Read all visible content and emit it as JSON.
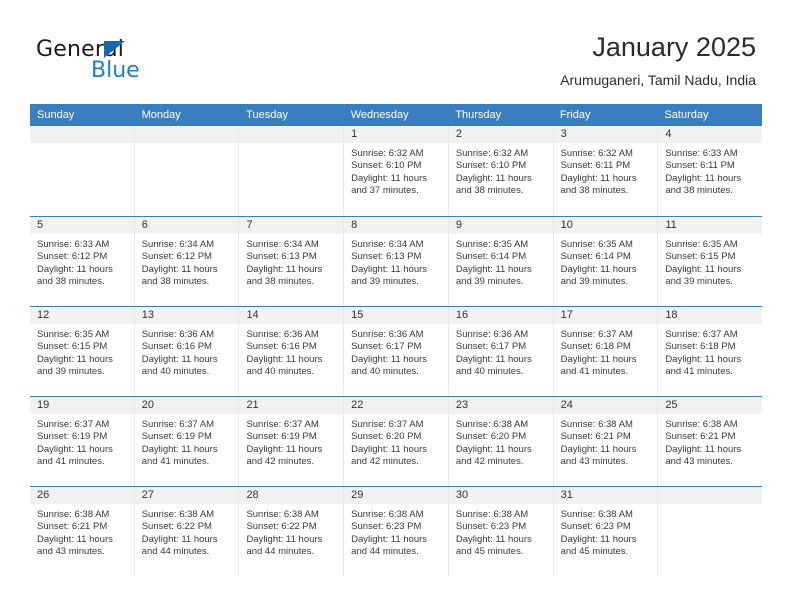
{
  "brand": {
    "name_part1": "General",
    "name_part2": "Blue",
    "triangle_color": "#1769b0",
    "blue_color": "#1f7fc4"
  },
  "header": {
    "title": "January 2025",
    "subtitle": "Arumuganeri, Tamil Nadu, India"
  },
  "theme": {
    "header_row_bg": "#3b7ebf",
    "day_number_bg": "#f1f1f1",
    "grid_line": "#3b7ebf",
    "cell_divider": "#e8e8e8"
  },
  "weekdays": [
    "Sunday",
    "Monday",
    "Tuesday",
    "Wednesday",
    "Thursday",
    "Friday",
    "Saturday"
  ],
  "labels": {
    "sunrise": "Sunrise:",
    "sunset": "Sunset:",
    "daylight": "Daylight:"
  },
  "weeks": [
    [
      {
        "day": "",
        "empty": true
      },
      {
        "day": "",
        "empty": true
      },
      {
        "day": "",
        "empty": true
      },
      {
        "day": "1",
        "sunrise": "Sunrise: 6:32 AM",
        "sunset": "Sunset: 6:10 PM",
        "daylight1": "Daylight: 11 hours",
        "daylight2": "and 37 minutes."
      },
      {
        "day": "2",
        "sunrise": "Sunrise: 6:32 AM",
        "sunset": "Sunset: 6:10 PM",
        "daylight1": "Daylight: 11 hours",
        "daylight2": "and 38 minutes."
      },
      {
        "day": "3",
        "sunrise": "Sunrise: 6:32 AM",
        "sunset": "Sunset: 6:11 PM",
        "daylight1": "Daylight: 11 hours",
        "daylight2": "and 38 minutes."
      },
      {
        "day": "4",
        "sunrise": "Sunrise: 6:33 AM",
        "sunset": "Sunset: 6:11 PM",
        "daylight1": "Daylight: 11 hours",
        "daylight2": "and 38 minutes."
      }
    ],
    [
      {
        "day": "5",
        "sunrise": "Sunrise: 6:33 AM",
        "sunset": "Sunset: 6:12 PM",
        "daylight1": "Daylight: 11 hours",
        "daylight2": "and 38 minutes."
      },
      {
        "day": "6",
        "sunrise": "Sunrise: 6:34 AM",
        "sunset": "Sunset: 6:12 PM",
        "daylight1": "Daylight: 11 hours",
        "daylight2": "and 38 minutes."
      },
      {
        "day": "7",
        "sunrise": "Sunrise: 6:34 AM",
        "sunset": "Sunset: 6:13 PM",
        "daylight1": "Daylight: 11 hours",
        "daylight2": "and 38 minutes."
      },
      {
        "day": "8",
        "sunrise": "Sunrise: 6:34 AM",
        "sunset": "Sunset: 6:13 PM",
        "daylight1": "Daylight: 11 hours",
        "daylight2": "and 39 minutes."
      },
      {
        "day": "9",
        "sunrise": "Sunrise: 6:35 AM",
        "sunset": "Sunset: 6:14 PM",
        "daylight1": "Daylight: 11 hours",
        "daylight2": "and 39 minutes."
      },
      {
        "day": "10",
        "sunrise": "Sunrise: 6:35 AM",
        "sunset": "Sunset: 6:14 PM",
        "daylight1": "Daylight: 11 hours",
        "daylight2": "and 39 minutes."
      },
      {
        "day": "11",
        "sunrise": "Sunrise: 6:35 AM",
        "sunset": "Sunset: 6:15 PM",
        "daylight1": "Daylight: 11 hours",
        "daylight2": "and 39 minutes."
      }
    ],
    [
      {
        "day": "12",
        "sunrise": "Sunrise: 6:35 AM",
        "sunset": "Sunset: 6:15 PM",
        "daylight1": "Daylight: 11 hours",
        "daylight2": "and 39 minutes."
      },
      {
        "day": "13",
        "sunrise": "Sunrise: 6:36 AM",
        "sunset": "Sunset: 6:16 PM",
        "daylight1": "Daylight: 11 hours",
        "daylight2": "and 40 minutes."
      },
      {
        "day": "14",
        "sunrise": "Sunrise: 6:36 AM",
        "sunset": "Sunset: 6:16 PM",
        "daylight1": "Daylight: 11 hours",
        "daylight2": "and 40 minutes."
      },
      {
        "day": "15",
        "sunrise": "Sunrise: 6:36 AM",
        "sunset": "Sunset: 6:17 PM",
        "daylight1": "Daylight: 11 hours",
        "daylight2": "and 40 minutes."
      },
      {
        "day": "16",
        "sunrise": "Sunrise: 6:36 AM",
        "sunset": "Sunset: 6:17 PM",
        "daylight1": "Daylight: 11 hours",
        "daylight2": "and 40 minutes."
      },
      {
        "day": "17",
        "sunrise": "Sunrise: 6:37 AM",
        "sunset": "Sunset: 6:18 PM",
        "daylight1": "Daylight: 11 hours",
        "daylight2": "and 41 minutes."
      },
      {
        "day": "18",
        "sunrise": "Sunrise: 6:37 AM",
        "sunset": "Sunset: 6:18 PM",
        "daylight1": "Daylight: 11 hours",
        "daylight2": "and 41 minutes."
      }
    ],
    [
      {
        "day": "19",
        "sunrise": "Sunrise: 6:37 AM",
        "sunset": "Sunset: 6:19 PM",
        "daylight1": "Daylight: 11 hours",
        "daylight2": "and 41 minutes."
      },
      {
        "day": "20",
        "sunrise": "Sunrise: 6:37 AM",
        "sunset": "Sunset: 6:19 PM",
        "daylight1": "Daylight: 11 hours",
        "daylight2": "and 41 minutes."
      },
      {
        "day": "21",
        "sunrise": "Sunrise: 6:37 AM",
        "sunset": "Sunset: 6:19 PM",
        "daylight1": "Daylight: 11 hours",
        "daylight2": "and 42 minutes."
      },
      {
        "day": "22",
        "sunrise": "Sunrise: 6:37 AM",
        "sunset": "Sunset: 6:20 PM",
        "daylight1": "Daylight: 11 hours",
        "daylight2": "and 42 minutes."
      },
      {
        "day": "23",
        "sunrise": "Sunrise: 6:38 AM",
        "sunset": "Sunset: 6:20 PM",
        "daylight1": "Daylight: 11 hours",
        "daylight2": "and 42 minutes."
      },
      {
        "day": "24",
        "sunrise": "Sunrise: 6:38 AM",
        "sunset": "Sunset: 6:21 PM",
        "daylight1": "Daylight: 11 hours",
        "daylight2": "and 43 minutes."
      },
      {
        "day": "25",
        "sunrise": "Sunrise: 6:38 AM",
        "sunset": "Sunset: 6:21 PM",
        "daylight1": "Daylight: 11 hours",
        "daylight2": "and 43 minutes."
      }
    ],
    [
      {
        "day": "26",
        "sunrise": "Sunrise: 6:38 AM",
        "sunset": "Sunset: 6:21 PM",
        "daylight1": "Daylight: 11 hours",
        "daylight2": "and 43 minutes."
      },
      {
        "day": "27",
        "sunrise": "Sunrise: 6:38 AM",
        "sunset": "Sunset: 6:22 PM",
        "daylight1": "Daylight: 11 hours",
        "daylight2": "and 44 minutes."
      },
      {
        "day": "28",
        "sunrise": "Sunrise: 6:38 AM",
        "sunset": "Sunset: 6:22 PM",
        "daylight1": "Daylight: 11 hours",
        "daylight2": "and 44 minutes."
      },
      {
        "day": "29",
        "sunrise": "Sunrise: 6:38 AM",
        "sunset": "Sunset: 6:23 PM",
        "daylight1": "Daylight: 11 hours",
        "daylight2": "and 44 minutes."
      },
      {
        "day": "30",
        "sunrise": "Sunrise: 6:38 AM",
        "sunset": "Sunset: 6:23 PM",
        "daylight1": "Daylight: 11 hours",
        "daylight2": "and 45 minutes."
      },
      {
        "day": "31",
        "sunrise": "Sunrise: 6:38 AM",
        "sunset": "Sunset: 6:23 PM",
        "daylight1": "Daylight: 11 hours",
        "daylight2": "and 45 minutes."
      },
      {
        "day": "",
        "empty": true
      }
    ]
  ]
}
